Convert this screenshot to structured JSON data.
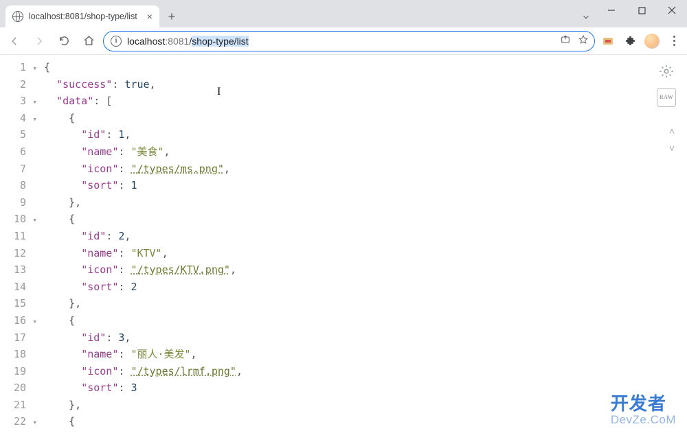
{
  "window": {
    "minimize": "—",
    "maximize": "□",
    "close": "×"
  },
  "tab": {
    "title": "localhost:8081/shop-type/list",
    "close": "×",
    "add": "+"
  },
  "toolbar": {
    "url_host": "localhost",
    "url_port": ":8081",
    "url_path_plain": "/",
    "url_path_selected": "shop-type/list",
    "info": "i"
  },
  "json": {
    "success_key": "\"success\"",
    "success_val": "true",
    "data_key": "\"data\"",
    "items": [
      {
        "id": 1,
        "name": "美食",
        "icon": "/types/ms.png",
        "sort": 1
      },
      {
        "id": 2,
        "name": "KTV",
        "icon": "/types/KTV.png",
        "sort": 2
      },
      {
        "id": 3,
        "name": "丽人·美发",
        "icon": "/types/lrmf.png",
        "sort": 3
      }
    ],
    "key_id": "\"id\"",
    "key_name": "\"name\"",
    "key_icon": "\"icon\"",
    "key_sort": "\"sort\""
  },
  "raw_label": "RAW",
  "scroll_up": "˄",
  "scroll_down": "˅",
  "watermark": {
    "line1": "开发者",
    "line2": "DevZe.CoM"
  },
  "line_numbers": [
    "1",
    "2",
    "3",
    "4",
    "5",
    "6",
    "7",
    "8",
    "9",
    "10",
    "11",
    "12",
    "13",
    "14",
    "15",
    "16",
    "17",
    "18",
    "19",
    "20",
    "21",
    "22"
  ]
}
